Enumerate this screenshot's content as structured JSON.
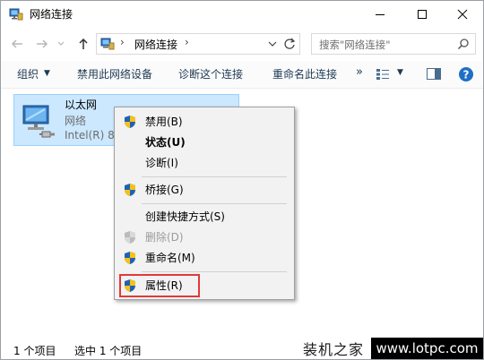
{
  "window": {
    "title": "网络连接",
    "icons": {
      "app": "network-connections-icon",
      "minimize": "minimize-icon",
      "maximize": "maximize-icon",
      "close": "close-icon"
    }
  },
  "nav": {
    "address_separator": "›",
    "address_text": "网络连接",
    "address_crumb_arrow": "›",
    "search_placeholder": "搜索\"网络连接\""
  },
  "commands": {
    "organize": "组织",
    "organize_caret": "▼",
    "disable_device": "禁用此网络设备",
    "diagnose": "诊断这个连接",
    "rename": "重命名此连接",
    "more": "»",
    "view_caret": "▼"
  },
  "connection": {
    "name": "以太网",
    "type": "网络",
    "device": "Intel(R) 82"
  },
  "context_menu": {
    "items": [
      {
        "label": "禁用(B)",
        "shield": true
      },
      {
        "label": "状态(U)",
        "shield": false,
        "bold": true
      },
      {
        "label": "诊断(I)",
        "shield": false
      },
      {
        "label": "桥接(G)",
        "shield": true
      },
      {
        "label": "创建快捷方式(S)",
        "shield": false
      },
      {
        "label": "删除(D)",
        "shield": true,
        "disabled": true
      },
      {
        "label": "重命名(M)",
        "shield": true
      },
      {
        "label": "属性(R)",
        "shield": true,
        "highlighted": true
      }
    ],
    "highlight_color": "#e2393a"
  },
  "status": {
    "item_count": "1 个项目",
    "selected": "选中 1 个项目"
  },
  "watermark": {
    "site_name": "装机之家",
    "url": "www.lotpc.com"
  },
  "colors": {
    "selection_bg": "#cce8ff",
    "selection_border": "#99d1ff",
    "menu_bg": "#f2f2f2",
    "command_text": "#1e3955"
  }
}
